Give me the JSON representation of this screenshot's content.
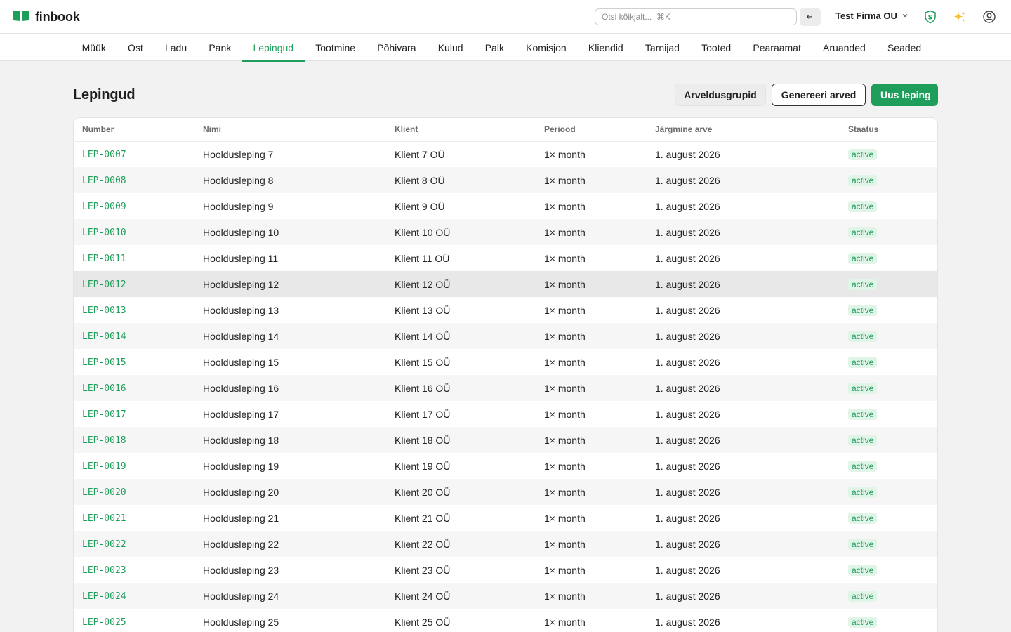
{
  "app": {
    "name": "finbook",
    "accent_color": "#1e9e5a"
  },
  "search": {
    "placeholder": "Otsi kõikjalt...  ⌘K",
    "value": ""
  },
  "topbar": {
    "enter_symbol": "↵",
    "company": "Test Firma OU",
    "icons": [
      "shield-s-icon",
      "sparkles-icon",
      "user-circle-icon"
    ]
  },
  "nav": {
    "tabs": [
      "Müük",
      "Ost",
      "Ladu",
      "Pank",
      "Lepingud",
      "Tootmine",
      "Põhivara",
      "Kulud",
      "Palk",
      "Komisjon",
      "Kliendid",
      "Tarnijad",
      "Tooted",
      "Pearaamat",
      "Aruanded",
      "Seaded"
    ],
    "active": "Lepingud"
  },
  "page": {
    "title": "Lepingud",
    "buttons": {
      "groups": "Arveldusgrupid",
      "generate": "Genereeri arved",
      "new": "Uus leping"
    }
  },
  "table": {
    "columns": [
      "Number",
      "Nimi",
      "Klient",
      "Periood",
      "Järgmine arve",
      "Staatus"
    ],
    "hover_row": "LEP-0012",
    "rows": [
      [
        "LEP-0007",
        "Hooldusleping 7",
        "Klient 7 OÜ",
        "1× month",
        "1. august 2026",
        "active"
      ],
      [
        "LEP-0008",
        "Hooldusleping 8",
        "Klient 8 OÜ",
        "1× month",
        "1. august 2026",
        "active"
      ],
      [
        "LEP-0009",
        "Hooldusleping 9",
        "Klient 9 OÜ",
        "1× month",
        "1. august 2026",
        "active"
      ],
      [
        "LEP-0010",
        "Hooldusleping 10",
        "Klient 10 OÜ",
        "1× month",
        "1. august 2026",
        "active"
      ],
      [
        "LEP-0011",
        "Hooldusleping 11",
        "Klient 11 OÜ",
        "1× month",
        "1. august 2026",
        "active"
      ],
      [
        "LEP-0012",
        "Hooldusleping 12",
        "Klient 12 OÜ",
        "1× month",
        "1. august 2026",
        "active"
      ],
      [
        "LEP-0013",
        "Hooldusleping 13",
        "Klient 13 OÜ",
        "1× month",
        "1. august 2026",
        "active"
      ],
      [
        "LEP-0014",
        "Hooldusleping 14",
        "Klient 14 OÜ",
        "1× month",
        "1. august 2026",
        "active"
      ],
      [
        "LEP-0015",
        "Hooldusleping 15",
        "Klient 15 OÜ",
        "1× month",
        "1. august 2026",
        "active"
      ],
      [
        "LEP-0016",
        "Hooldusleping 16",
        "Klient 16 OÜ",
        "1× month",
        "1. august 2026",
        "active"
      ],
      [
        "LEP-0017",
        "Hooldusleping 17",
        "Klient 17 OÜ",
        "1× month",
        "1. august 2026",
        "active"
      ],
      [
        "LEP-0018",
        "Hooldusleping 18",
        "Klient 18 OÜ",
        "1× month",
        "1. august 2026",
        "active"
      ],
      [
        "LEP-0019",
        "Hooldusleping 19",
        "Klient 19 OÜ",
        "1× month",
        "1. august 2026",
        "active"
      ],
      [
        "LEP-0020",
        "Hooldusleping 20",
        "Klient 20 OÜ",
        "1× month",
        "1. august 2026",
        "active"
      ],
      [
        "LEP-0021",
        "Hooldusleping 21",
        "Klient 21 OÜ",
        "1× month",
        "1. august 2026",
        "active"
      ],
      [
        "LEP-0022",
        "Hooldusleping 22",
        "Klient 22 OÜ",
        "1× month",
        "1. august 2026",
        "active"
      ],
      [
        "LEP-0023",
        "Hooldusleping 23",
        "Klient 23 OÜ",
        "1× month",
        "1. august 2026",
        "active"
      ],
      [
        "LEP-0024",
        "Hooldusleping 24",
        "Klient 24 OÜ",
        "1× month",
        "1. august 2026",
        "active"
      ],
      [
        "LEP-0025",
        "Hooldusleping 25",
        "Klient 25 OÜ",
        "1× month",
        "1. august 2026",
        "active"
      ]
    ]
  }
}
